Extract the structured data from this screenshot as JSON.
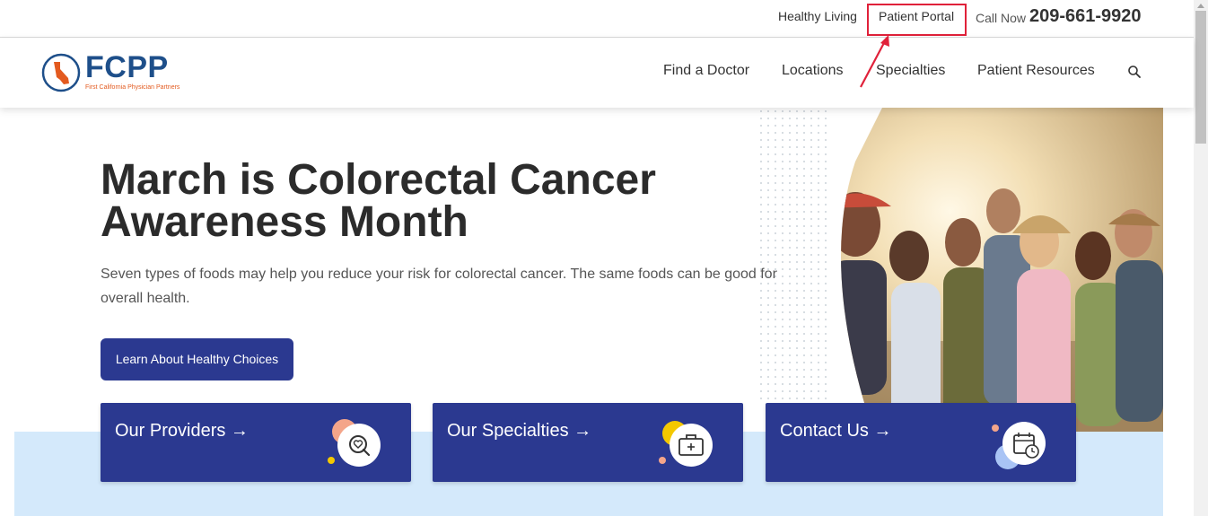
{
  "topbar": {
    "healthy_living": "Healthy Living",
    "patient_portal": "Patient Portal",
    "call_label": "Call Now",
    "phone": "209-661-9920"
  },
  "logo": {
    "name": "FCPP",
    "tagline": "First California Physician Partners"
  },
  "nav": {
    "items": [
      "Find a Doctor",
      "Locations",
      "Specialties",
      "Patient Resources"
    ],
    "search_icon": "search-icon"
  },
  "hero": {
    "title": "March is Colorectal Cancer Awareness Month",
    "description": "Seven types of foods may help you reduce your risk for colorectal cancer. The same foods can be good for overall health.",
    "cta": "Learn About Healthy Choices"
  },
  "cards": [
    {
      "title": "Our Providers →",
      "icon": "heart-search-icon"
    },
    {
      "title": "Our Specialties →",
      "icon": "medical-kit-icon"
    },
    {
      "title": "Contact Us →",
      "icon": "calendar-clock-icon"
    }
  ],
  "colors": {
    "primary": "#2b3990",
    "annotation": "#e0213a",
    "hero_bottom": "#d4e9fb",
    "logo_blue": "#1e4f8a",
    "logo_orange": "#e35a1f"
  }
}
